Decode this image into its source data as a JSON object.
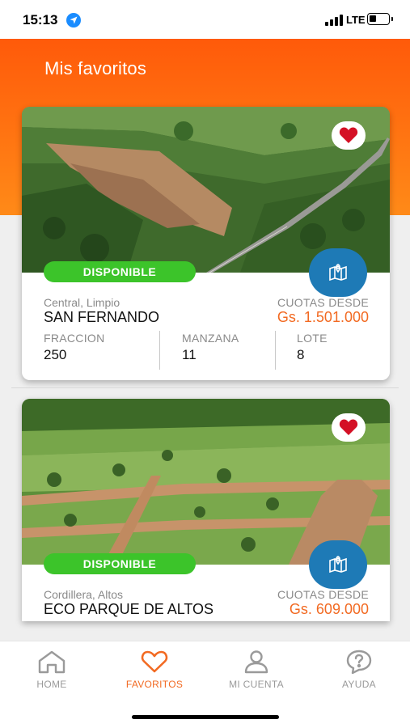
{
  "status_bar": {
    "time": "15:13",
    "network": "LTE",
    "location_icon": "location-arrow-icon"
  },
  "header": {
    "title": "Mis favoritos"
  },
  "colors": {
    "brand_orange": "#ff6a10",
    "available_green": "#3cc42a",
    "map_blue": "#1e7ab6",
    "price_orange": "#f26a22"
  },
  "favorites": [
    {
      "status": "DISPONIBLE",
      "location": "Central, Limpio",
      "name": "SAN FERNANDO",
      "installments_label": "CUOTAS DESDE",
      "price": "Gs. 1.501.000",
      "fraccion_label": "FRACCION",
      "fraccion": "250",
      "manzana_label": "MANZANA",
      "manzana": "11",
      "lote_label": "LOTE",
      "lote": "8",
      "favorite_icon": "heart-icon",
      "map_icon": "map-pin-icon"
    },
    {
      "status": "DISPONIBLE",
      "location": "Cordillera, Altos",
      "name": "ECO PARQUE DE ALTOS",
      "installments_label": "CUOTAS DESDE",
      "price": "Gs. 609.000",
      "favorite_icon": "heart-icon",
      "map_icon": "map-pin-icon"
    }
  ],
  "tabs": [
    {
      "label": "HOME",
      "icon": "home-icon",
      "active": false
    },
    {
      "label": "FAVORITOS",
      "icon": "heart-outline-icon",
      "active": true
    },
    {
      "label": "MI CUENTA",
      "icon": "user-icon",
      "active": false
    },
    {
      "label": "AYUDA",
      "icon": "help-bubble-icon",
      "active": false
    }
  ]
}
